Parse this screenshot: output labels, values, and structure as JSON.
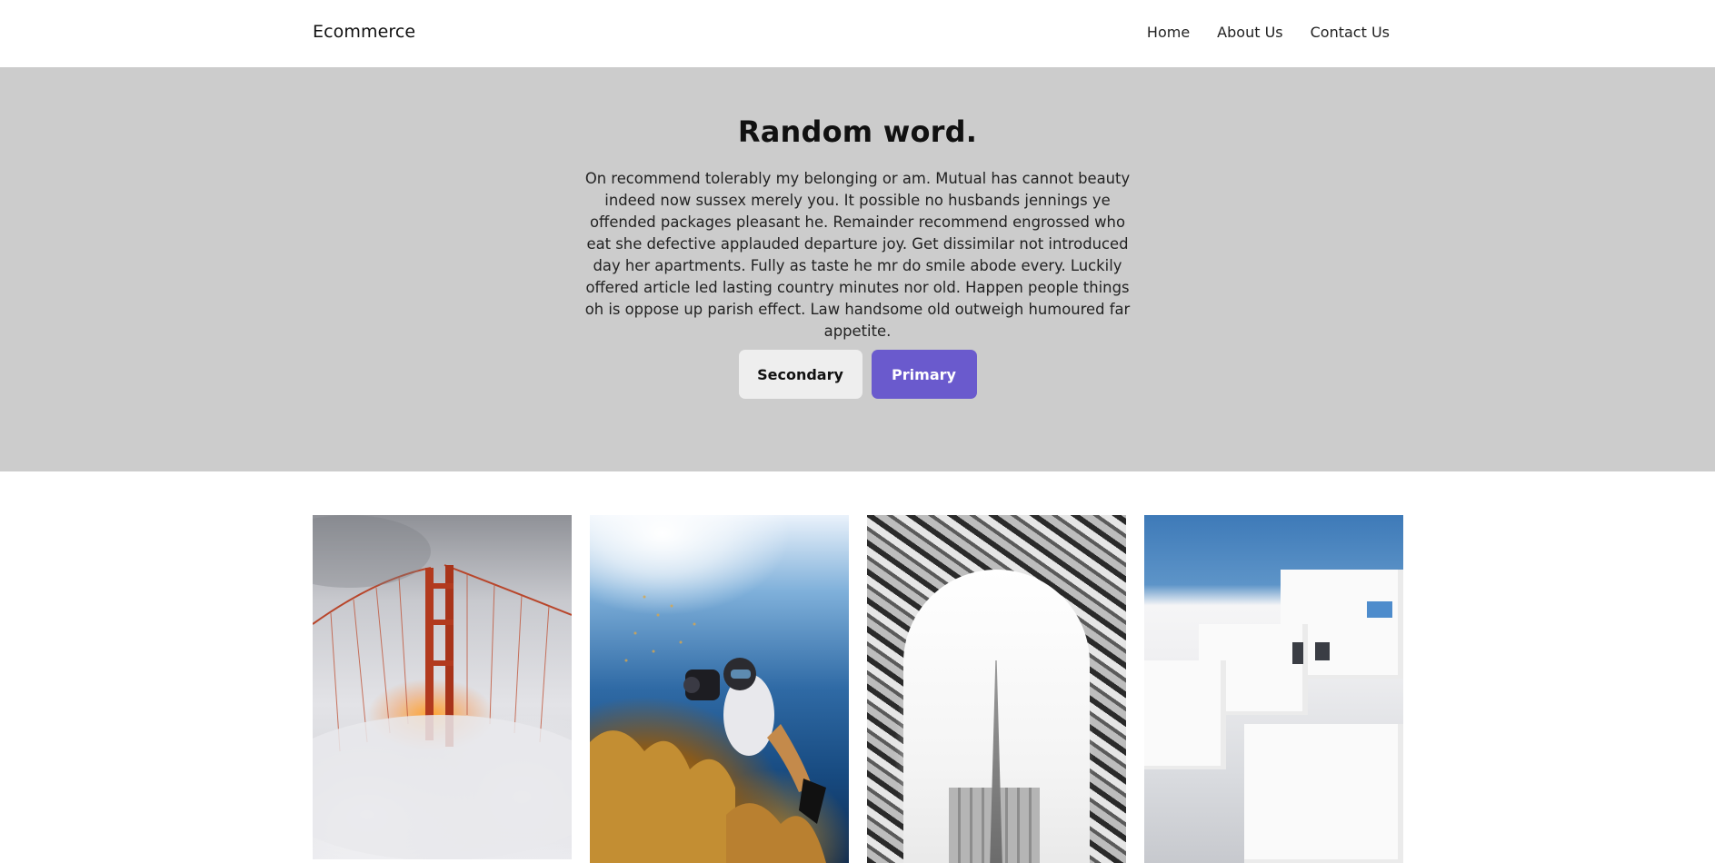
{
  "navbar": {
    "brand": "Ecommerce",
    "links": [
      {
        "label": "Home"
      },
      {
        "label": "About Us"
      },
      {
        "label": "Contact Us"
      }
    ]
  },
  "hero": {
    "title": "Random word.",
    "text": "On recommend tolerably my belonging or am. Mutual has cannot beauty indeed now sussex merely you. It possible no husbands jennings ye offended packages pleasant he. Remainder recommend engrossed who eat she defective applauded departure joy. Get dissimilar not introduced day her apartments. Fully as taste he mr do smile abode every. Luckily offered article led lasting country minutes nor old. Happen people things oh is oppose up parish effect. Law handsome old outweigh humoured far appetite.",
    "buttons": {
      "secondary": "Secondary",
      "primary": "Primary"
    },
    "colors": {
      "background": "#cccccc",
      "primary": "#6a5acd",
      "secondary": "#eeeeee"
    }
  },
  "gallery": {
    "photos": [
      {
        "subject": "golden-gate-bridge-in-fog"
      },
      {
        "subject": "diver-with-camera-underwater"
      },
      {
        "subject": "black-and-white-calligraphy-architecture"
      },
      {
        "subject": "white-cycladic-buildings"
      }
    ]
  }
}
